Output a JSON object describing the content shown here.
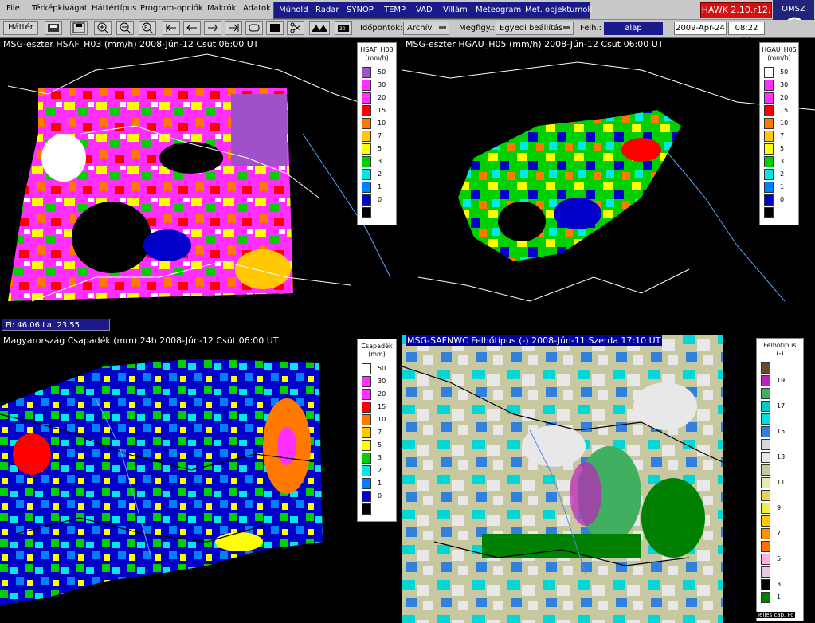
{
  "menubar": {
    "items": [
      "File",
      "Térképkivágat",
      "Háttértípus",
      "Program-opciók",
      "Makrók",
      "Adatok"
    ],
    "hawk_items": [
      "Műhold",
      "Radar",
      "SYNOP",
      "TEMP",
      "VAD",
      "Villám",
      "Meteogram",
      "Met. objektumok"
    ],
    "version": "HAWK 2.10.r12.",
    "logo": "OMSZ"
  },
  "toolbar": {
    "hatter_label": "Háttér",
    "idopontok_label": "Időpontok:",
    "archiv_value": "Archív",
    "megfigy_label": "Megfigy.:",
    "egyedi_value": "Egyedi beállítás",
    "felh_label": "Felh.:",
    "felh_value": "alap",
    "date": "2009-Apr-24",
    "time": "08:22 UT",
    "icons": [
      "save-icon",
      "disk-icon",
      "zoom-in-icon",
      "zoom-out-icon",
      "zoom-reset-icon",
      "pan-left-end-icon",
      "pan-left-icon",
      "pan-right-icon",
      "pan-right-end-icon",
      "loop-icon",
      "fill-icon",
      "scissors-icon",
      "mountain-icon",
      "camera-icon"
    ]
  },
  "panels": [
    {
      "title": "MSG-eszter  HSAF_H03 (mm/h)  2008-Jún-12 Csüt 06:00 UT",
      "legend_title": "HSAF_H03",
      "legend_unit": "(mm/h)"
    },
    {
      "title": "MSG-eszter  HGAU_H05 (mm/h)  2008-Jún-12 Csüt 06:00 UT",
      "legend_title": "HGAU_H05",
      "legend_unit": "(mm/h)"
    },
    {
      "title": "Magyarország Csapadék (mm)  24h  2008-Jún-12 Csüt 06:00 UT",
      "legend_title": "Csapadék",
      "legend_unit": "(mm)"
    },
    {
      "title": "MSG-SAFNWC  Felhőtípus (-)  2008-Jún-11 Szerda 17:10 UT",
      "legend_title": "Felhotipus",
      "legend_unit": "(-)"
    }
  ],
  "precip_legend": {
    "labels": [
      "50",
      "30",
      "20",
      "15",
      "10",
      "7",
      "5",
      "3",
      "2",
      "1",
      "0"
    ],
    "colors": [
      "#a050c8",
      "#ff30ff",
      "#ff30ff",
      "#ff0000",
      "#ff7800",
      "#ffc800",
      "#ffff00",
      "#00d000",
      "#00e8e8",
      "#0080ff",
      "#0000c8",
      "#000000"
    ]
  },
  "cloud_legend": {
    "labels": [
      "19",
      "17",
      "15",
      "13",
      "11",
      "9",
      "7",
      "5",
      "3",
      "1"
    ],
    "colors": [
      "#6b4a2a",
      "#c020c0",
      "#40b060",
      "#00c8c8",
      "#00e0e0",
      "#3080e0",
      "#d8d8d8",
      "#e8e8e8",
      "#c8c8a0",
      "#e8e8b8",
      "#e8d060",
      "#f0f040",
      "#ffc800",
      "#ff9000",
      "#ff7000",
      "#ffb0e0",
      "#e8c8e8",
      "#008000",
      "#000000",
      "#ffffff"
    ]
  },
  "coords": {
    "label": "Fi:  46.06  La:   23.55"
  },
  "status_tail": "Teljes cap. Fo"
}
